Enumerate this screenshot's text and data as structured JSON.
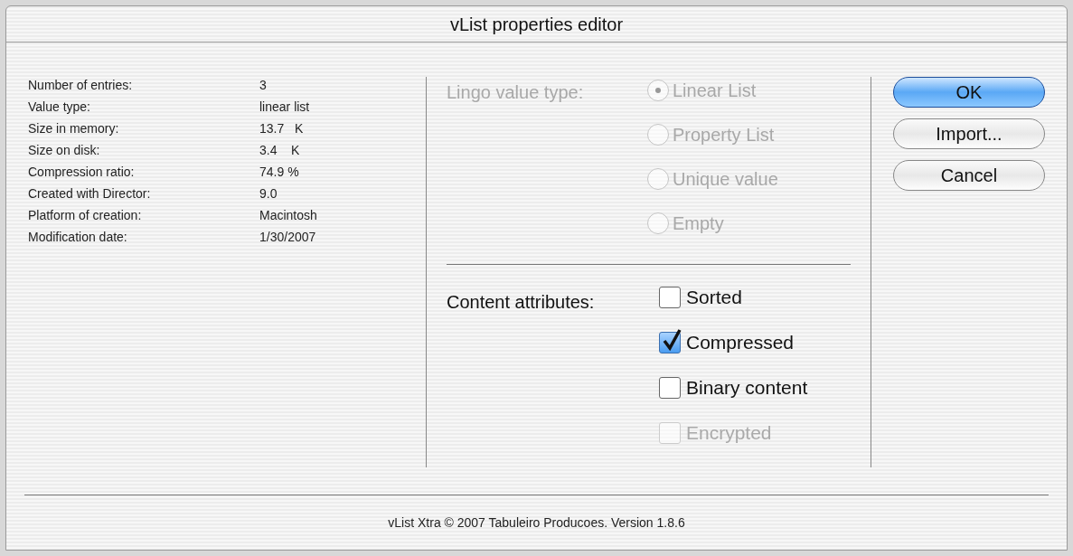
{
  "window": {
    "title": "vList properties editor"
  },
  "info": [
    {
      "label": "Number of entries:",
      "value": "3"
    },
    {
      "label": "Value type:",
      "value": "linear list"
    },
    {
      "label": "Size in memory:",
      "value": "13.7   K"
    },
    {
      "label": "Size on disk:",
      "value": "3.4    K"
    },
    {
      "label": "Compression ratio:",
      "value": "74.9 %"
    },
    {
      "label": "Created with Director:",
      "value": "9.0"
    },
    {
      "label": "Platform of creation:",
      "value": "Macintosh"
    },
    {
      "label": "Modification date:",
      "value": "1/30/2007"
    }
  ],
  "value_type": {
    "label": "Lingo value type:",
    "disabled": true,
    "options": [
      {
        "label": "Linear List",
        "selected": true
      },
      {
        "label": "Property List",
        "selected": false
      },
      {
        "label": "Unique value",
        "selected": false
      },
      {
        "label": "Empty",
        "selected": false
      }
    ]
  },
  "content_attributes": {
    "label": "Content attributes:",
    "options": [
      {
        "label": "Sorted",
        "checked": false,
        "disabled": false
      },
      {
        "label": "Compressed",
        "checked": true,
        "disabled": false
      },
      {
        "label": "Binary content",
        "checked": false,
        "disabled": false
      },
      {
        "label": "Encrypted",
        "checked": false,
        "disabled": true
      }
    ]
  },
  "buttons": [
    {
      "label": "OK",
      "kind": "default"
    },
    {
      "label": "Import...",
      "kind": "normal"
    },
    {
      "label": "Cancel",
      "kind": "normal"
    }
  ],
  "footer": "vList Xtra © 2007 Tabuleiro Producoes. Version 1.8.6"
}
